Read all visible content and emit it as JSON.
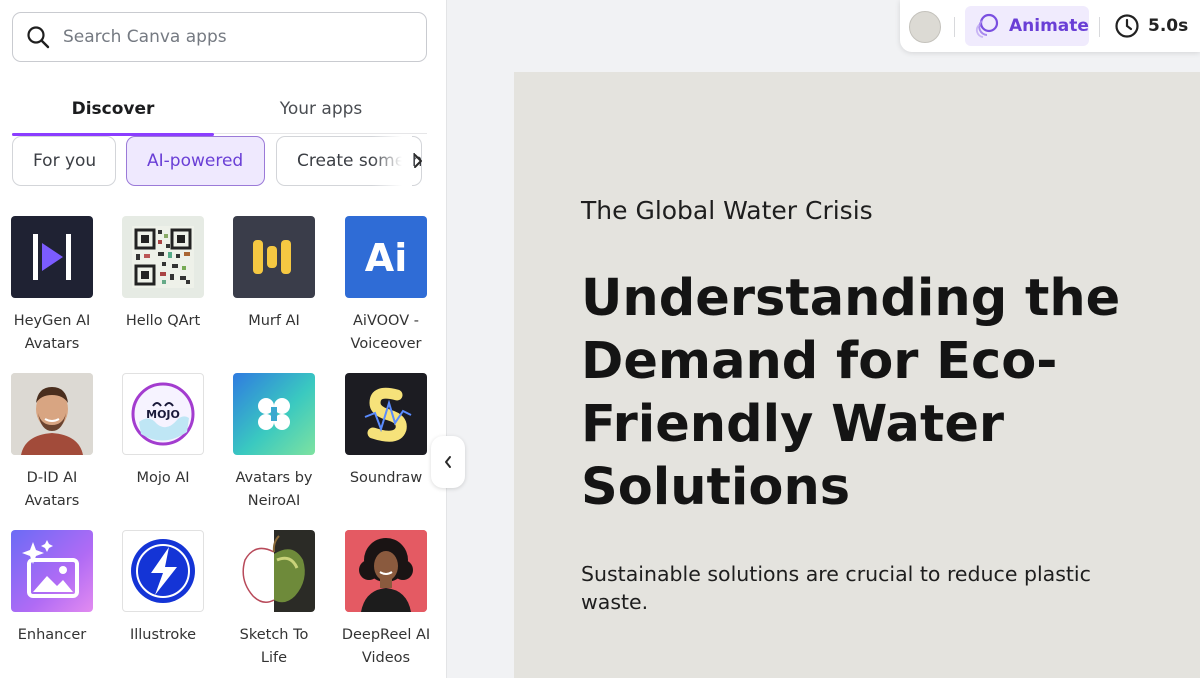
{
  "search": {
    "placeholder": "Search Canva apps"
  },
  "tabs": [
    {
      "label": "Discover"
    },
    {
      "label": "Your apps"
    }
  ],
  "filters": [
    {
      "label": "For you"
    },
    {
      "label": "AI-powered"
    },
    {
      "label": "Create something"
    }
  ],
  "accent_color": "#8b3dff",
  "apps": [
    {
      "name": "HeyGen AI Avatars",
      "icon": "heygen-logo-icon"
    },
    {
      "name": "Hello QArt",
      "icon": "qr-art-icon"
    },
    {
      "name": "Murf AI",
      "icon": "murf-logo-icon"
    },
    {
      "name": "AiVOOV - Voiceover",
      "icon": "ai-letters-icon",
      "icon_text": "Ai"
    },
    {
      "name": "D-ID AI Avatars",
      "icon": "man-portrait-icon"
    },
    {
      "name": "Mojo AI",
      "icon": "mojo-logo-icon",
      "icon_text": "MOJO"
    },
    {
      "name": "Avatars by NeiroAI",
      "icon": "butterfly-icon"
    },
    {
      "name": "Soundraw",
      "icon": "soundraw-logo-icon"
    },
    {
      "name": "Enhancer",
      "icon": "image-sparkle-icon"
    },
    {
      "name": "Illustroke",
      "icon": "lightning-icon"
    },
    {
      "name": "Sketch To Life",
      "icon": "apple-sketch-icon"
    },
    {
      "name": "DeepReel AI Videos",
      "icon": "woman-portrait-icon"
    }
  ],
  "toolbar": {
    "animate_label": "Animate",
    "duration": "5.0s"
  },
  "slide": {
    "subtitle": "The Global Water Crisis",
    "headline": "Understanding the Demand for Eco-Friendly Water Solutions",
    "body": "Sustainable solutions are crucial to reduce plastic waste."
  }
}
